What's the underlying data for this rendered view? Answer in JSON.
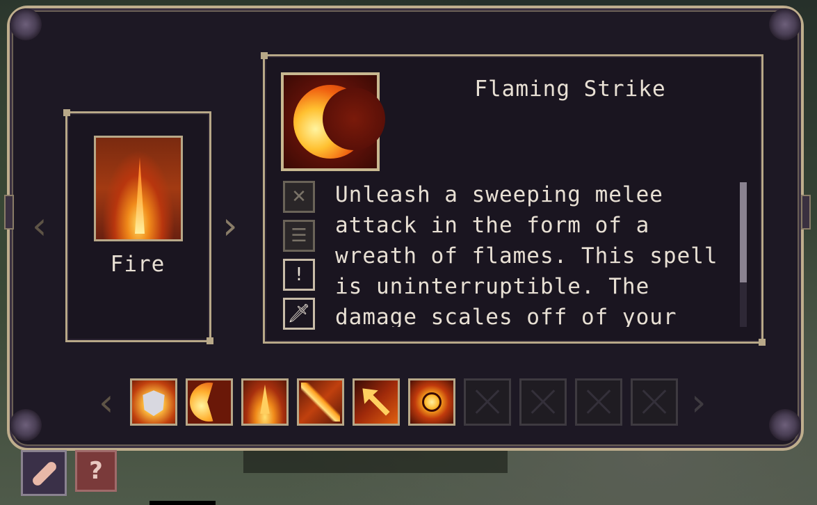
{
  "school": {
    "name": "Fire",
    "prev_arrow": "‹",
    "next_arrow": "›"
  },
  "spell": {
    "title": "Flaming Strike",
    "description": "Unleash a sweeping melee attack in the form of a wreath of flames. This spell is uninterruptible. The damage scales off of your",
    "properties": [
      {
        "name": "cancel-icon",
        "glyph": "✕"
      },
      {
        "name": "list-icon",
        "glyph": "☰"
      },
      {
        "name": "alert-icon",
        "glyph": "!"
      },
      {
        "name": "sword-icon",
        "glyph": "🗡"
      }
    ],
    "scroll_fraction": 0.69
  },
  "spell_bar": {
    "prev_arrow": "‹",
    "next_arrow": "›",
    "slots": [
      {
        "name": "spell-slot-fire-shield",
        "filled": true
      },
      {
        "name": "spell-slot-flaming-strike",
        "filled": true
      },
      {
        "name": "spell-slot-fire-burst",
        "filled": true
      },
      {
        "name": "spell-slot-flame-slash",
        "filled": true
      },
      {
        "name": "spell-slot-fire-arrow",
        "filled": true
      },
      {
        "name": "spell-slot-sun-burst",
        "filled": true
      },
      {
        "name": "spell-slot-empty-1",
        "filled": false
      },
      {
        "name": "spell-slot-empty-2",
        "filled": false
      },
      {
        "name": "spell-slot-empty-3",
        "filled": false
      },
      {
        "name": "spell-slot-empty-4",
        "filled": false
      }
    ]
  },
  "bottom_buttons": {
    "scroll_icon": "scroll-icon",
    "help_label": "?"
  },
  "colors": {
    "panel_bg": "#1d1824",
    "frame_gold": "#b8a888",
    "text": "#e8e0d4",
    "fire": "#f08a1a"
  }
}
